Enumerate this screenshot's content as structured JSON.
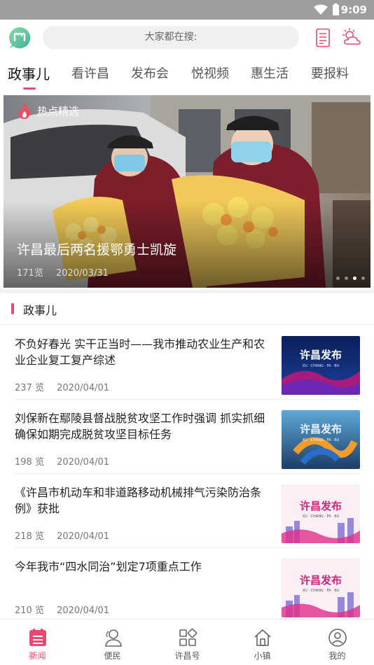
{
  "status_bar": {
    "time": "9:09"
  },
  "header": {
    "search_placeholder": "大家都在搜:"
  },
  "tabs": [
    {
      "label": "政事儿",
      "active": true
    },
    {
      "label": "看许昌",
      "active": false
    },
    {
      "label": "发布会",
      "active": false
    },
    {
      "label": "悦视频",
      "active": false
    },
    {
      "label": "惠生活",
      "active": false
    },
    {
      "label": "要报料",
      "active": false
    }
  ],
  "banner": {
    "tag": "热点精选",
    "title": "许昌最后两名援鄂勇士凯旋",
    "views": "171览",
    "date": "2020/03/31",
    "pages": 4,
    "current_page": 3
  },
  "section": {
    "title": "政事儿"
  },
  "news": [
    {
      "title": "不负好春光 实干正当时——我市推动农业生产和农业企业复工复产综述",
      "views": "237 览",
      "date": "2020/04/01",
      "thumb_text": "许昌发布",
      "thumb_sub": "XU · CHANG · FA · BU"
    },
    {
      "title": "刘保新在鄢陵县督战脱贫攻坚工作时强调 抓实抓细确保如期完成脱贫攻坚目标任务",
      "views": "198 览",
      "date": "2020/04/01",
      "thumb_text": "许昌发布",
      "thumb_sub": "XU · CHANG · FA · BU"
    },
    {
      "title": "《许昌市机动车和非道路移动机械排气污染防治条例》获批",
      "views": "218 览",
      "date": "2020/04/01",
      "thumb_text": "许昌发布",
      "thumb_sub": "XU · CHANG · FA · BU"
    },
    {
      "title": "今年我市“四水同治”划定7项重点工作",
      "views": "210 览",
      "date": "2020/04/01",
      "thumb_text": "许昌发布",
      "thumb_sub": "XU · CHANG · FA · BU"
    }
  ],
  "bottom_nav": [
    {
      "label": "新闻",
      "icon": "news-icon",
      "active": true
    },
    {
      "label": "便民",
      "icon": "people-icon",
      "active": false
    },
    {
      "label": "许昌号",
      "icon": "grid-icon",
      "active": false
    },
    {
      "label": "小镇",
      "icon": "home-icon",
      "active": false
    },
    {
      "label": "我的",
      "icon": "profile-icon",
      "active": false
    }
  ],
  "colors": {
    "accent": "#e84a6f",
    "status_bar": "#9e9e9e"
  }
}
